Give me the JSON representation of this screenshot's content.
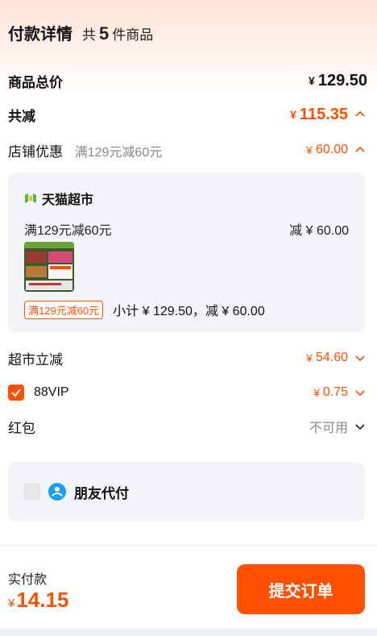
{
  "header": {
    "title": "付款详情",
    "count_prefix": "共",
    "count": "5",
    "count_suffix": "件商品"
  },
  "summary": {
    "total_label": "商品总价",
    "total_currency": "¥",
    "total_value": "129.50",
    "reduce_label": "共减",
    "reduce_currency": "¥",
    "reduce_value": "115.35"
  },
  "shop_discount": {
    "label": "店铺优惠",
    "sub": "满129元减60元",
    "currency": "¥",
    "value": "60.00"
  },
  "card": {
    "store_icon": "tmall-market-icon",
    "store_name": "天猫超市",
    "promo": "满129元减60元",
    "promo_reduce": "减 ¥ 60.00",
    "tag": "满129元减60元",
    "subtotal": "小计 ¥ 129.50，减 ¥ 60.00"
  },
  "market": {
    "label": "超市立减",
    "currency": "¥",
    "value": "54.60"
  },
  "vip": {
    "label": "88VIP",
    "checked": true,
    "currency": "¥",
    "value": "0.75"
  },
  "red_packet": {
    "label": "红包",
    "value": "不可用"
  },
  "friend_pay": {
    "label": "朋友代付",
    "checked": false
  },
  "footer": {
    "pay_label": "实付款",
    "currency": "¥",
    "amount": "14.15",
    "submit": "提交订单"
  },
  "colors": {
    "accent": "#ff5000",
    "card_bg": "#f2f4f7"
  }
}
